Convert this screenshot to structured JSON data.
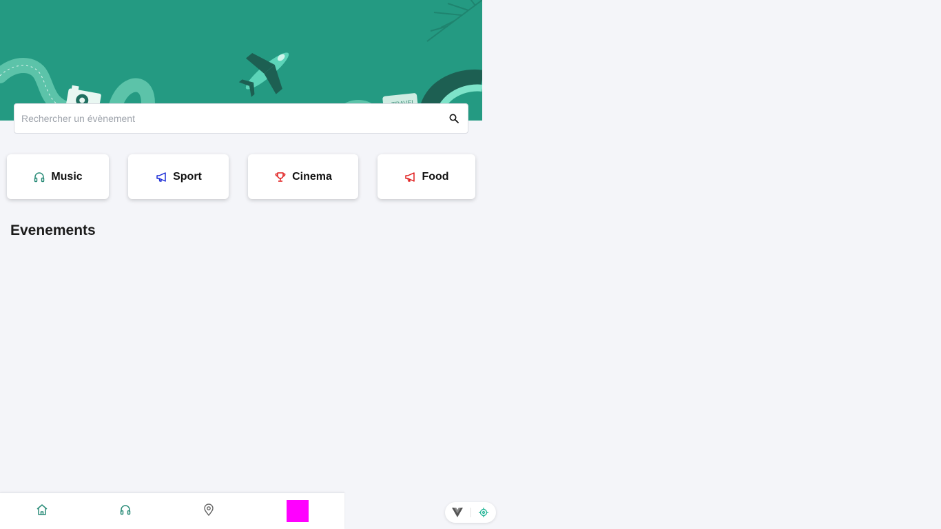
{
  "search": {
    "placeholder": "Rechercher un évènement",
    "icon": "search-icon"
  },
  "categories": [
    {
      "label": "Music",
      "icon": "headphones-icon",
      "color": "#2a8c78"
    },
    {
      "label": "Sport",
      "icon": "megaphone-icon",
      "color": "#1a2bd6"
    },
    {
      "label": "Cinema",
      "icon": "trophy-icon",
      "color": "#e01b1b"
    },
    {
      "label": "Food",
      "icon": "megaphone-icon",
      "color": "#e01b1b"
    }
  ],
  "events": {
    "title": "Evenements"
  },
  "tabbar": {
    "items": [
      {
        "icon": "home-icon"
      },
      {
        "icon": "headphones-icon"
      },
      {
        "icon": "location-pin-icon"
      },
      {
        "icon": "profile-avatar"
      }
    ]
  },
  "devtools": {
    "icons": [
      "vue-logo-icon",
      "crosshair-icon"
    ]
  },
  "colors": {
    "hero": "#249a82",
    "accent": "#2a8c78",
    "background": "#f4f5f9",
    "profile": "#ff00ff"
  }
}
